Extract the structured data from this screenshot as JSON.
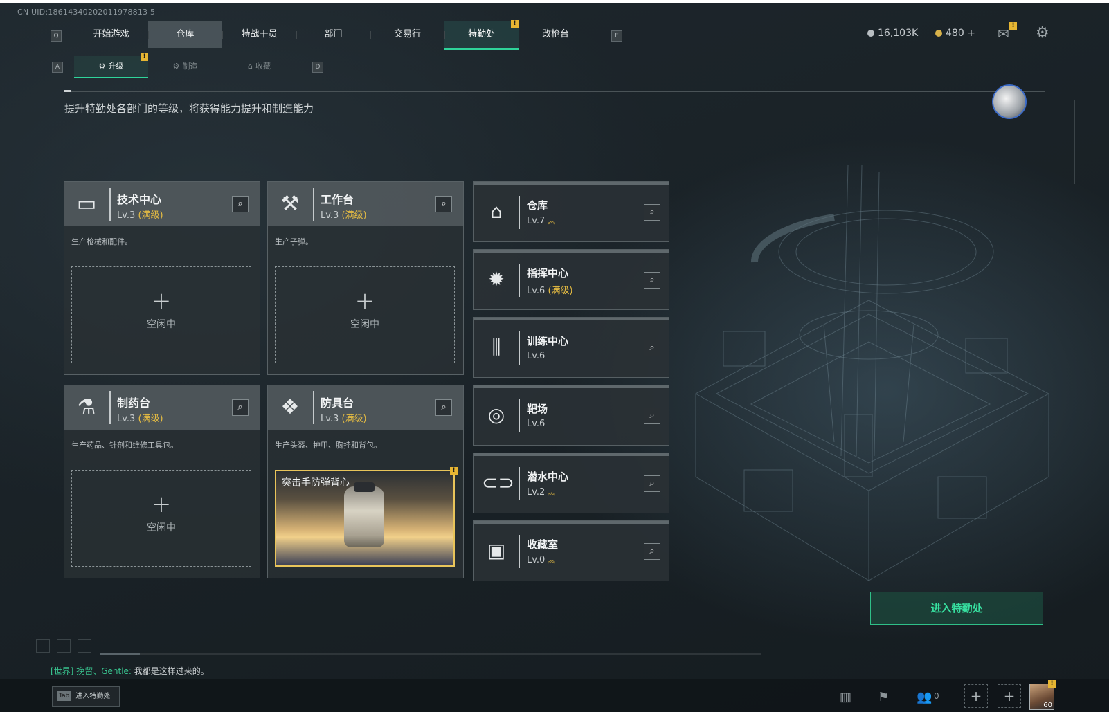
{
  "uid": "CN UID:18614340202011978813 5",
  "nav": {
    "tabs": [
      "开始游戏",
      "仓库",
      "特战干员",
      "部门",
      "交易行",
      "特勤处",
      "改枪台"
    ],
    "active_tab": "特勤处",
    "badge": "!",
    "key_left": "Q",
    "key_right": "E"
  },
  "subnav": {
    "tabs": [
      "升级",
      "制造",
      "收藏"
    ],
    "active": "升级",
    "key_left": "A",
    "key_right": "D",
    "badge": "!"
  },
  "currency": {
    "a": "16,103K",
    "b": "480 +"
  },
  "notify_badge": "!",
  "description": "提升特勤处各部门的等级，将获得能力提升和制造能力",
  "cards": [
    {
      "title": "技术中心",
      "lv": "Lv.3",
      "max": "(满级)",
      "desc": "生产枪械和配件。",
      "idle": "空闲中",
      "icon": "monitor-icon"
    },
    {
      "title": "工作台",
      "lv": "Lv.3",
      "max": "(满级)",
      "desc": "生产子弹。",
      "idle": "空闲中",
      "icon": "tools-icon"
    },
    {
      "title": "制药台",
      "lv": "Lv.3",
      "max": "(满级)",
      "desc": "生产药品、针剂和维修工具包。",
      "idle": "空闲中",
      "icon": "microscope-icon"
    },
    {
      "title": "防具台",
      "lv": "Lv.3",
      "max": "(满级)",
      "desc": "生产头盔、护甲、胸挂和背包。",
      "item": "突击手防弹背心",
      "icon": "boxes-icon"
    }
  ],
  "departments": [
    {
      "title": "仓库",
      "lv": "Lv.7",
      "max": "",
      "up": "≈",
      "icon": "warehouse-icon"
    },
    {
      "title": "指挥中心",
      "lv": "Lv.6",
      "max": "(满级)",
      "up": "",
      "icon": "command-icon"
    },
    {
      "title": "训练中心",
      "lv": "Lv.6",
      "max": "",
      "up": "",
      "icon": "dumbbell-icon"
    },
    {
      "title": "靶场",
      "lv": "Lv.6",
      "max": "",
      "up": "",
      "icon": "target-icon"
    },
    {
      "title": "潜水中心",
      "lv": "Lv.2",
      "max": "",
      "up": "≈",
      "icon": "goggles-icon"
    },
    {
      "title": "收藏室",
      "lv": "Lv.0",
      "max": "",
      "up": "≈",
      "icon": "vault-icon"
    }
  ],
  "enter_button": "进入特勤处",
  "chat": {
    "channel": "[世界]",
    "user": "挽留、Gentle:",
    "message": "我都是这样过来的。"
  },
  "tab_hint": {
    "key": "Tab",
    "label": "进入特勤处"
  },
  "social": {
    "friends_count": "0"
  },
  "player_level": "60",
  "player_badge": "!"
}
